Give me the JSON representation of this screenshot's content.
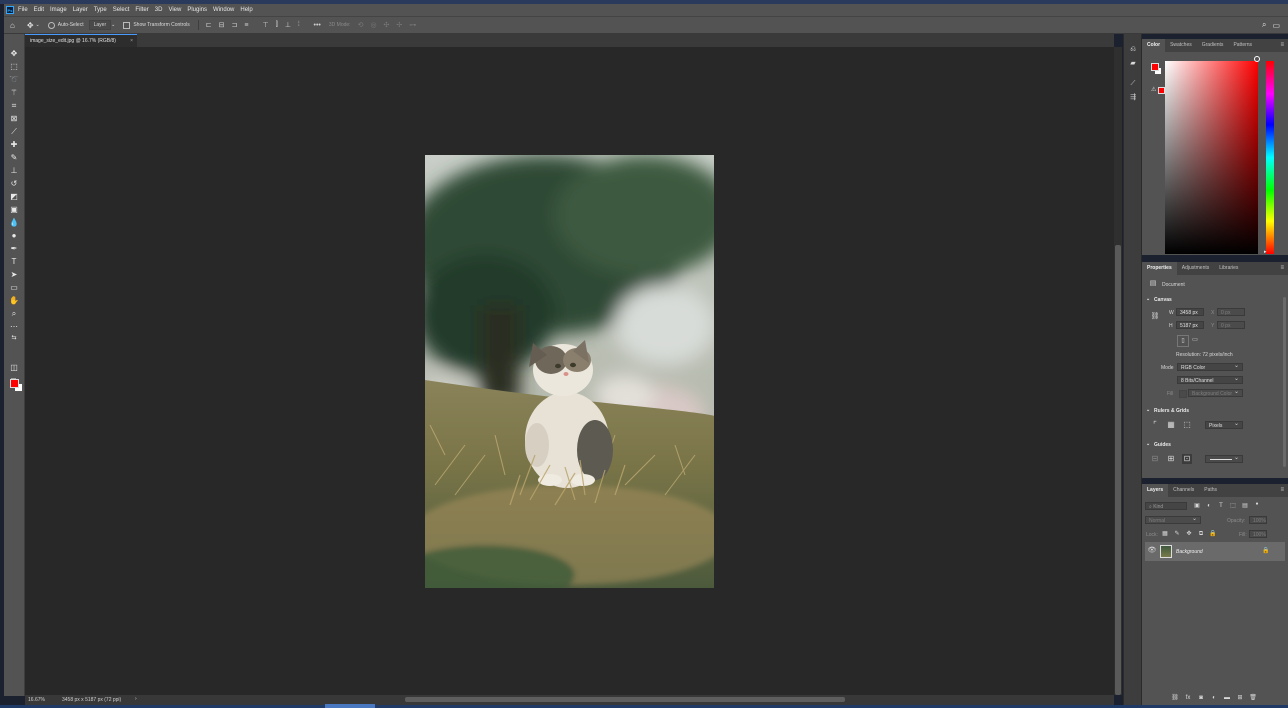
{
  "app": {
    "logo_text": "Ps"
  },
  "menu": [
    "File",
    "Edit",
    "Image",
    "Layer",
    "Type",
    "Select",
    "Filter",
    "3D",
    "View",
    "Plugins",
    "Window",
    "Help"
  ],
  "options_bar": {
    "auto_select_label": "Auto-Select",
    "auto_select_target": "Layer",
    "show_transform_label": "Show Transform Controls",
    "mode_3d_label": "3D Mode:"
  },
  "document_tab": {
    "title": "image_size_edit.jpg @ 16.7% (RGB/8)",
    "close": "×"
  },
  "status": {
    "zoom": "16.67%",
    "doc_info": "3458 px x 5187 px (72 ppi)",
    "arrow": "›"
  },
  "color_panel": {
    "tabs": [
      "Color",
      "Swatches",
      "Gradients",
      "Patterns"
    ],
    "active_tab": "Color",
    "fg_color": "#ff0000",
    "bg_color": "#ffffff"
  },
  "properties_panel": {
    "tabs": [
      "Properties",
      "Adjustments",
      "Libraries"
    ],
    "document_label": "Document",
    "canvas_section": "Canvas",
    "w_label": "W",
    "w_value": "3458 px",
    "h_label": "H",
    "h_value": "5187 px",
    "x_label": "X",
    "x_value": "0 px",
    "y_label": "Y",
    "y_value": "0 px",
    "resolution": "Resolution: 72 pixels/inch",
    "mode_label": "Mode",
    "mode_value": "RGB Color",
    "bit_depth": "8 Bits/Channel",
    "fill_label": "Fill",
    "fill_value": "Background Color",
    "rulers_section": "Rulers & Grids",
    "units_value": "Pixels",
    "guides_section": "Guides"
  },
  "layers_panel": {
    "tabs": [
      "Layers",
      "Channels",
      "Paths"
    ],
    "filter_placeholder": "Kind",
    "blend_mode": "Normal",
    "opacity_label": "Opacity:",
    "opacity_value": "100%",
    "lock_label": "Lock:",
    "fill_label": "Fill:",
    "fill_value": "100%",
    "layers": [
      {
        "name": "Background",
        "visible": true,
        "locked": true
      }
    ]
  }
}
